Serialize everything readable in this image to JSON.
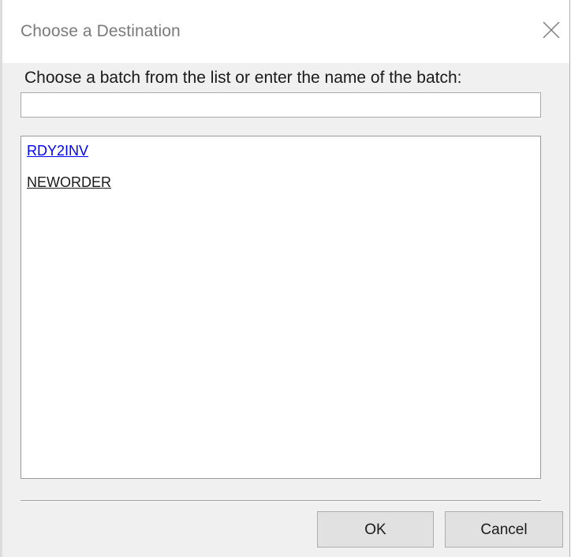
{
  "window": {
    "title": "Choose a Destination",
    "close_icon": "close-icon"
  },
  "prompt": {
    "label": "Choose a batch from the list or enter the name of the batch:"
  },
  "batch_input": {
    "value": "",
    "placeholder": ""
  },
  "batch_list": {
    "items": [
      {
        "label": "RDY2INV",
        "color": "#0000ff"
      },
      {
        "label": "NEWORDER",
        "color": "#1a1a1a"
      }
    ]
  },
  "buttons": {
    "ok_label": "OK",
    "cancel_label": "Cancel"
  },
  "colors": {
    "dialog_background": "#f0f0f0",
    "titlebar_background": "#ffffff",
    "link_color": "#0000ff"
  }
}
